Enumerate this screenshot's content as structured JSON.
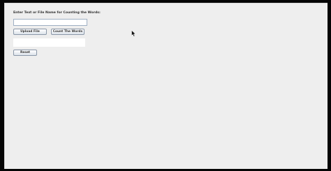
{
  "form": {
    "prompt_label": "Enter Text or File Name for Counting the Words:",
    "text_input": {
      "value": "",
      "placeholder": ""
    },
    "upload_button_label": "Upload File",
    "count_button_label": "Count The Words",
    "result_text": "",
    "reset_button_label": "Reset"
  },
  "icons": {
    "cursor": "mouse-pointer-icon"
  },
  "colors": {
    "panel_background": "#eeeeee",
    "frame_background": "#050505",
    "input_border": "#9fb0c4"
  }
}
